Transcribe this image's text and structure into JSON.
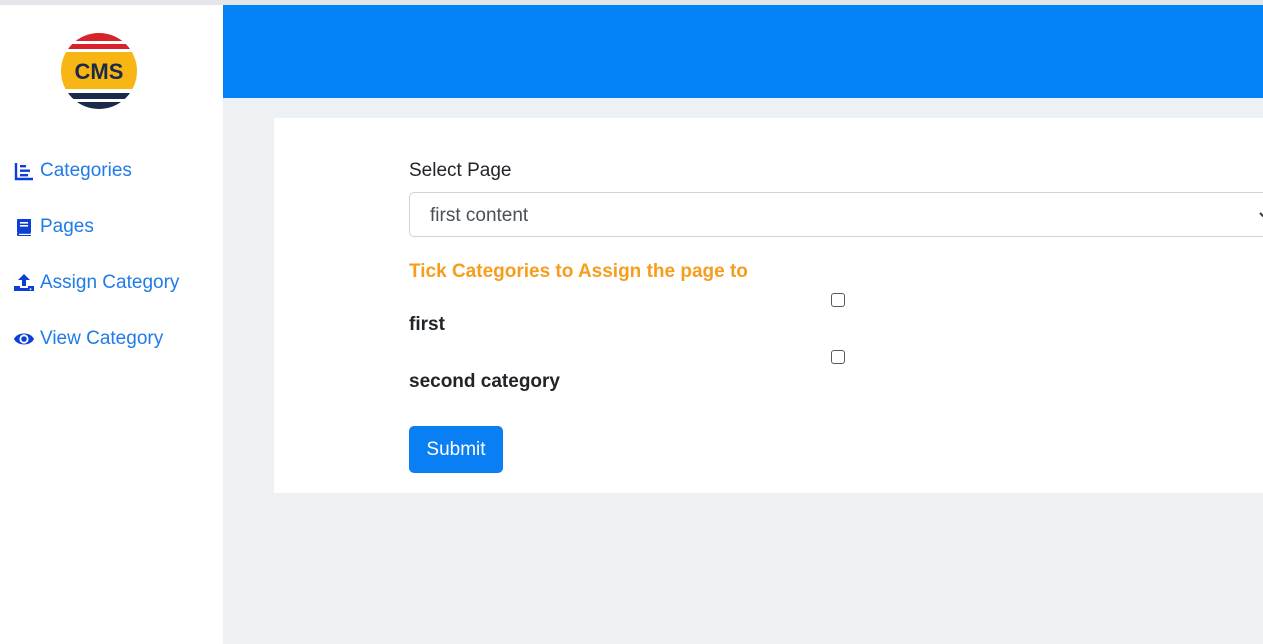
{
  "app": {
    "logo_text": "CMS"
  },
  "sidebar": {
    "items": [
      {
        "label": "Categories",
        "icon": "chart-bar-icon"
      },
      {
        "label": "Pages",
        "icon": "book-icon"
      },
      {
        "label": "Assign Category",
        "icon": "upload-icon"
      },
      {
        "label": "View Category",
        "icon": "eye-icon"
      }
    ]
  },
  "form": {
    "select_label": "Select Page",
    "select_value": "first content",
    "hint": "Tick Categories to Assign the page to",
    "categories": [
      {
        "name": "first",
        "checked": false
      },
      {
        "name": "second category",
        "checked": false
      }
    ],
    "submit_label": "Submit"
  },
  "colors": {
    "header": "#0282f6",
    "link": "#1f7be8",
    "hint": "#f79d1e",
    "button": "#0a7ef3",
    "background": "#edf1f4"
  }
}
